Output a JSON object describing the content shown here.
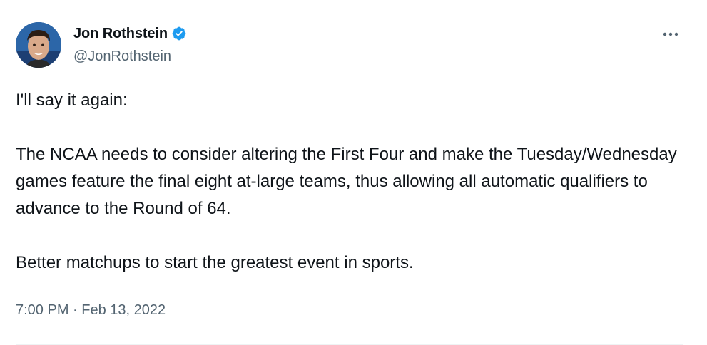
{
  "tweet": {
    "author": {
      "display_name": "Jon Rothstein",
      "handle": "@JonRothstein",
      "verified_icon": "verified-badge-icon",
      "avatar_icon": "avatar"
    },
    "more_icon": "more-options-icon",
    "body": [
      "I'll say it again:",
      "The NCAA needs to consider altering the First Four and make the Tuesday/Wednesday games feature the final eight at-large teams, thus allowing all automatic qualifiers to advance to the Round of 64.",
      "Better matchups to start the greatest event in sports."
    ],
    "timestamp": {
      "time": "7:00 PM",
      "separator": "·",
      "date": "Feb 13, 2022"
    }
  },
  "colors": {
    "text": "#0f1419",
    "secondary_text": "#536471",
    "verified_blue": "#1d9bf0",
    "divider": "#eff3f4"
  }
}
